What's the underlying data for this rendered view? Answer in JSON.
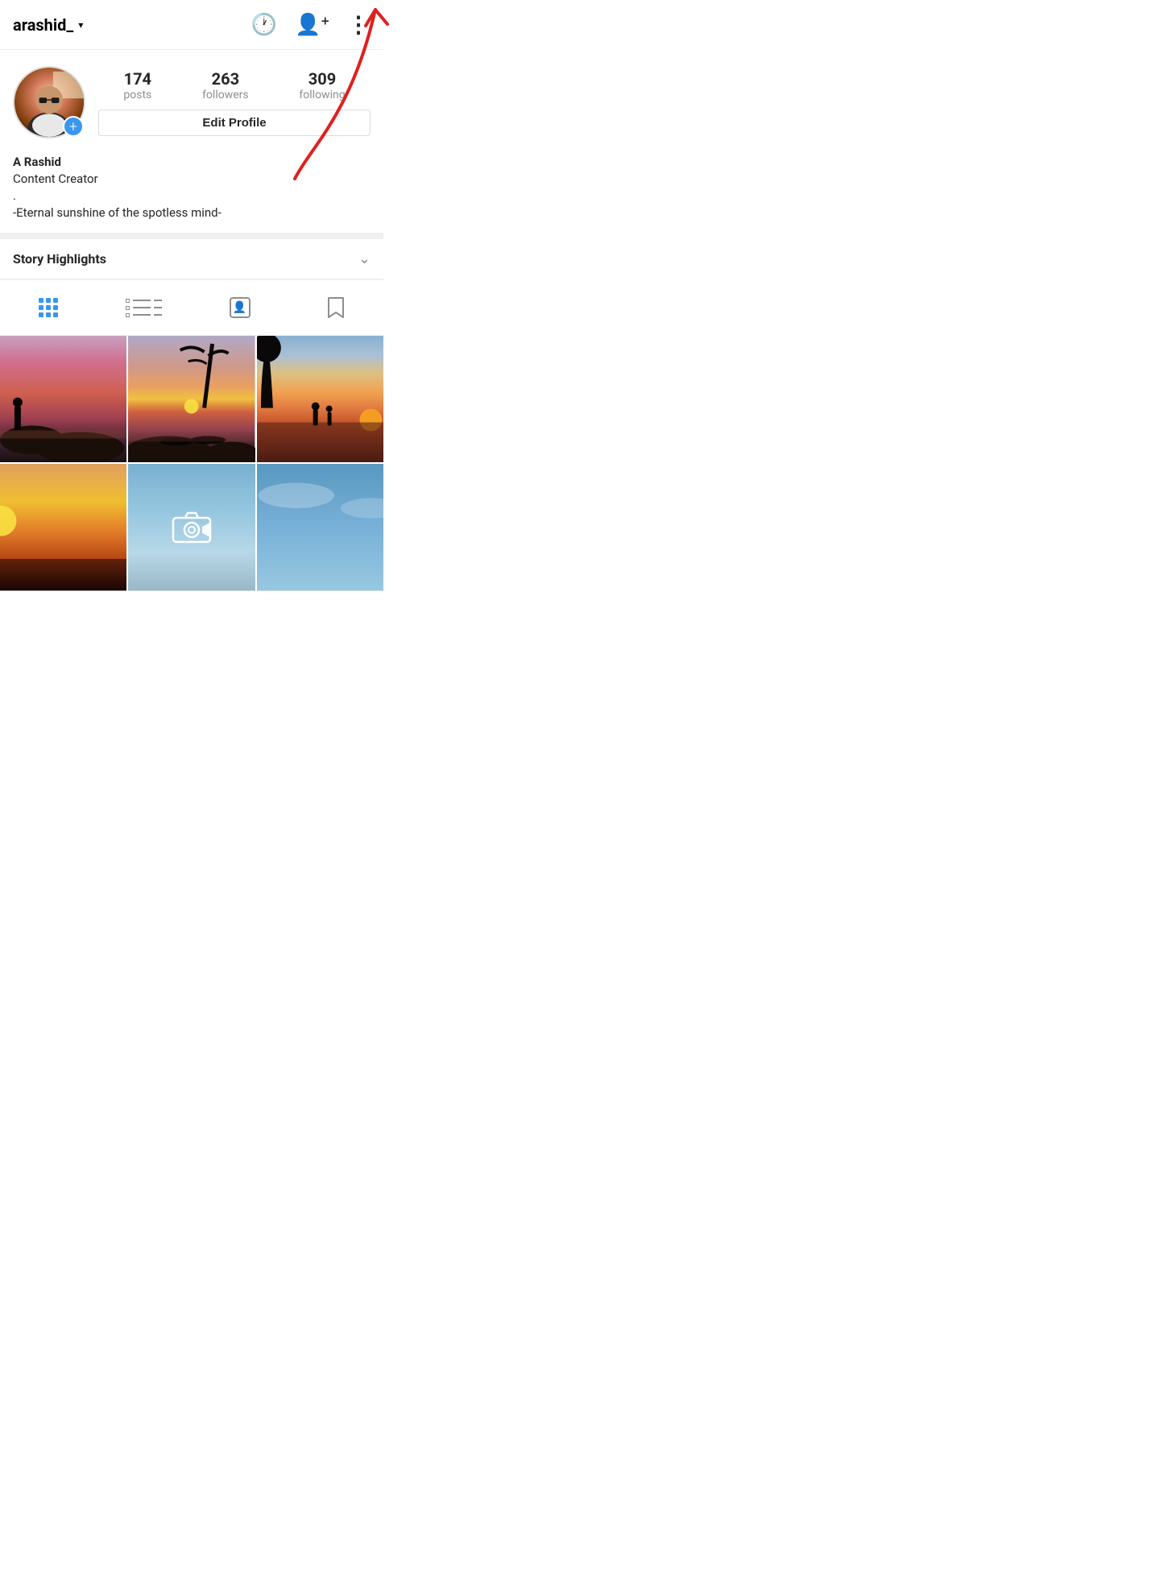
{
  "header": {
    "username": "arashid_",
    "dropdown_label": "▾"
  },
  "profile": {
    "stats": {
      "posts_count": "174",
      "posts_label": "posts",
      "followers_count": "263",
      "followers_label": "followers",
      "following_count": "309",
      "following_label": "following"
    },
    "edit_profile_label": "Edit Profile",
    "plus_icon": "+",
    "name": "A Rashid",
    "role": "Content Creator",
    "dot": ".",
    "quote": "-Eternal sunshine of the spotless mind-"
  },
  "highlights": {
    "title": "Story Highlights",
    "chevron": "∨"
  },
  "tabs": {
    "grid_label": "grid",
    "list_label": "list",
    "person_label": "tagged",
    "bookmark_label": "saved"
  },
  "nav_icons": {
    "history": "↺",
    "add_person": "⊕",
    "more": "⋮"
  },
  "annotation": {
    "arrow_color": "#e02020"
  }
}
